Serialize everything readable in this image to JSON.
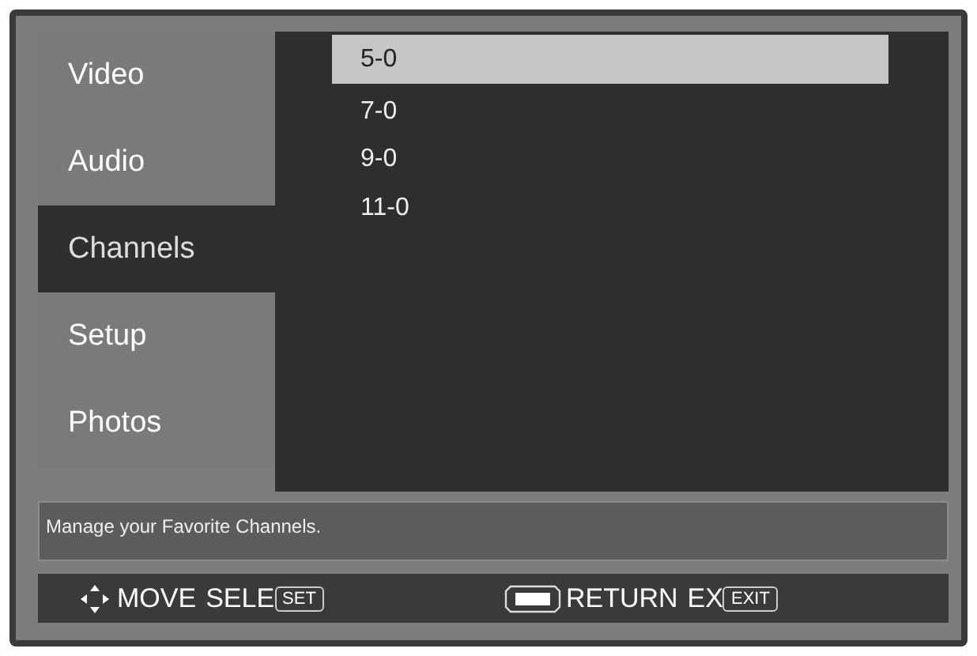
{
  "menu": [
    {
      "label": "Video",
      "selected": false
    },
    {
      "label": "Audio",
      "selected": false
    },
    {
      "label": "Channels",
      "selected": true
    },
    {
      "label": "Setup",
      "selected": false
    },
    {
      "label": "Photos",
      "selected": false
    }
  ],
  "channels": [
    {
      "label": "5-0",
      "selected": true
    },
    {
      "label": "7-0",
      "selected": false
    },
    {
      "label": "9-0",
      "selected": false
    },
    {
      "label": "11-0",
      "selected": false
    }
  ],
  "description": "Manage your Favorite Channels.",
  "legend": [
    {
      "kind": "dpad",
      "label": "MOVE"
    },
    {
      "kind": "text",
      "label": "SELE",
      "key": "SET"
    },
    {
      "kind": "blank-key",
      "label": "RETURN"
    },
    {
      "kind": "text",
      "label": "EX",
      "key": "EXIT"
    }
  ]
}
